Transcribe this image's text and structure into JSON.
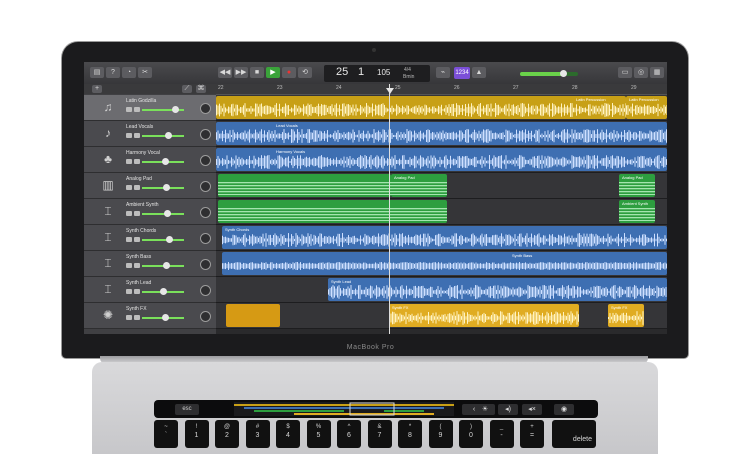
{
  "device": {
    "model_label": "MacBook Pro"
  },
  "transport": {
    "bar": "25",
    "beat": "1",
    "tempo": "105",
    "time_signature": "4/4",
    "key": "Bmin",
    "count_in": "1234"
  },
  "ruler": {
    "bar_numbers": [
      "22",
      "23",
      "24",
      "25",
      "26",
      "27",
      "28",
      "29"
    ]
  },
  "tracks": [
    {
      "name": "Latin Godzilla",
      "icon": "drum-kit-icon",
      "selected": true,
      "fader": 0.78
    },
    {
      "name": "Lead Vocals",
      "icon": "microphone-icon",
      "selected": false,
      "fader": 0.62
    },
    {
      "name": "Harmony Vocal",
      "icon": "choir-icon",
      "selected": false,
      "fader": 0.55
    },
    {
      "name": "Analog Pad",
      "icon": "keyboard-icon",
      "selected": false,
      "fader": 0.58
    },
    {
      "name": "Ambient Synth",
      "icon": "synth-stand-icon",
      "selected": false,
      "fader": 0.6
    },
    {
      "name": "Synth Chords",
      "icon": "synth-stand-icon",
      "selected": false,
      "fader": 0.64
    },
    {
      "name": "Synth Bass",
      "icon": "synth-stand-icon",
      "selected": false,
      "fader": 0.56
    },
    {
      "name": "Synth Lead",
      "icon": "synth-stand-icon",
      "selected": false,
      "fader": 0.5
    },
    {
      "name": "Synth FX",
      "icon": "sparkle-icon",
      "selected": false,
      "fader": 0.54
    }
  ],
  "regions": {
    "r0a": "Latin Percussion",
    "r0b": "Latin Percussion",
    "r1": "Lead Vocals",
    "r2": "Harmony Vocals",
    "r3a": "Analog Pad",
    "r3b": "Analog Pad",
    "r4": "Ambient Synth",
    "r5": "Synth Chords",
    "r6": "Synth Bass",
    "r7": "Synth Lead",
    "r8a": "Synth FX",
    "r8b": "Synth FX"
  },
  "touchbar": {
    "esc": "esc"
  },
  "keyboard": {
    "keys": [
      {
        "top": "~",
        "bottom": "`"
      },
      {
        "top": "!",
        "bottom": "1"
      },
      {
        "top": "@",
        "bottom": "2"
      },
      {
        "top": "#",
        "bottom": "3"
      },
      {
        "top": "$",
        "bottom": "4"
      },
      {
        "top": "%",
        "bottom": "5"
      },
      {
        "top": "^",
        "bottom": "6"
      },
      {
        "top": "&",
        "bottom": "7"
      },
      {
        "top": "*",
        "bottom": "8"
      },
      {
        "top": "(",
        "bottom": "9"
      },
      {
        "top": ")",
        "bottom": "0"
      },
      {
        "top": "_",
        "bottom": "-"
      },
      {
        "top": "+",
        "bottom": "="
      }
    ],
    "delete": "delete"
  }
}
